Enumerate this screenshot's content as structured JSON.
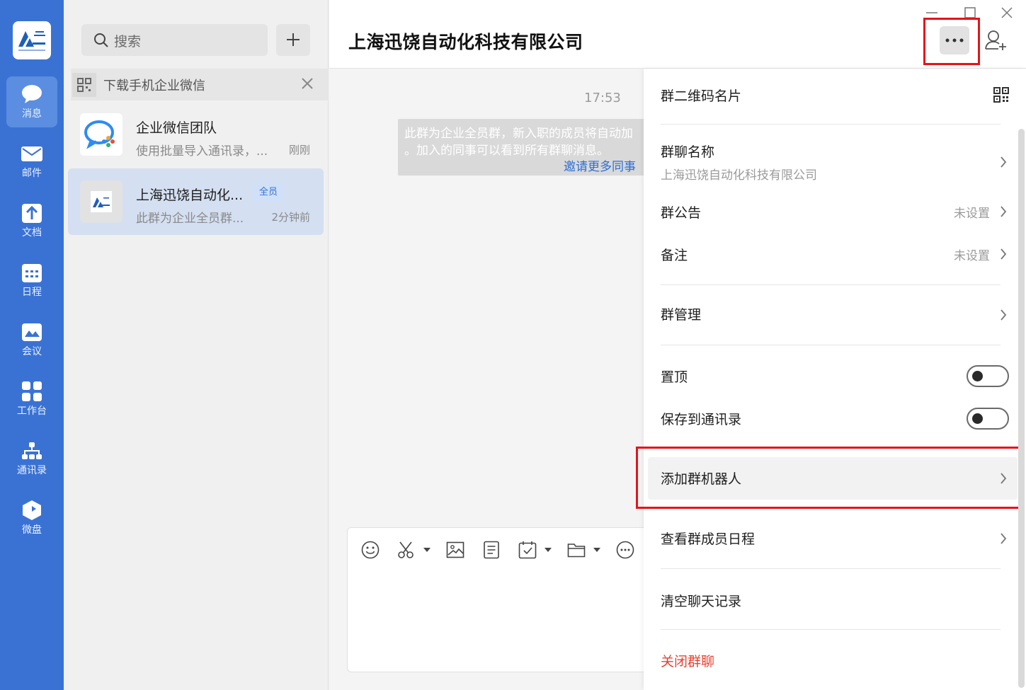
{
  "nav": {
    "items": [
      {
        "label": "消息"
      },
      {
        "label": "邮件"
      },
      {
        "label": "文档"
      },
      {
        "label": "日程"
      },
      {
        "label": "会议"
      },
      {
        "label": "工作台"
      },
      {
        "label": "通讯录"
      },
      {
        "label": "微盘"
      }
    ],
    "accent": "#3a72d4"
  },
  "list": {
    "search_placeholder": "搜索",
    "banner_text": "下载手机企业微信",
    "conversations": [
      {
        "name": "企业微信团队",
        "preview": "使用批量导入通讯录，...",
        "time": "刚刚"
      },
      {
        "name": "上海迅饶自动化...",
        "badge": "全员",
        "preview": "此群为企业全员群...",
        "time": "2分钟前"
      }
    ]
  },
  "chat": {
    "title": "上海迅饶自动化科技有限公司",
    "message_time": "17:53",
    "system_message": {
      "line1": "此群为企业全员群，新入职的成员将自动加",
      "line2": "。加入的同事可以看到所有群聊消息。",
      "link": "邀请更多同事"
    }
  },
  "settings": {
    "qr_card": "群二维码名片",
    "group_name_label": "群聊名称",
    "group_name_value": "上海迅饶自动化科技有限公司",
    "announcement_label": "群公告",
    "announcement_value": "未设置",
    "remark_label": "备注",
    "remark_value": "未设置",
    "manage_label": "群管理",
    "pin_label": "置顶",
    "pin_on": false,
    "save_contacts_label": "保存到通讯录",
    "save_contacts_on": false,
    "add_robot_label": "添加群机器人",
    "member_schedule_label": "查看群成员日程",
    "clear_history_label": "清空聊天记录",
    "close_group_label": "关闭群聊",
    "danger_color": "#e8412f",
    "highlight_color": "#e8121a"
  }
}
